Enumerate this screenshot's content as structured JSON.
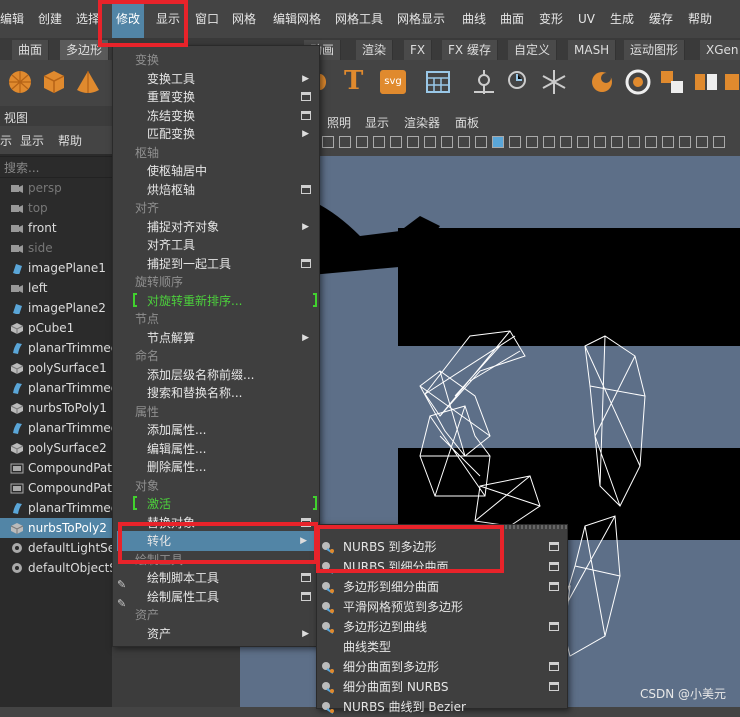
{
  "menubar": {
    "items": [
      "编辑",
      "创建",
      "选择",
      "修改",
      "显示",
      "窗口",
      "网格",
      "编辑网格",
      "网格工具",
      "网格显示",
      "曲线",
      "曲面",
      "变形",
      "UV",
      "生成",
      "缓存",
      "帮助"
    ],
    "active": "修改"
  },
  "shelf_tabs": [
    "曲面",
    "多边形",
    "动画",
    "渲染",
    "FX",
    "FX 缓存",
    "自定义",
    "MASH",
    "运动图形",
    "XGen"
  ],
  "shelf": {
    "text_icon": "T",
    "svg_icon": "svg"
  },
  "outliner": {
    "title": "视图",
    "menu": [
      "示",
      "显示",
      "帮助"
    ],
    "search_placeholder": "搜索...",
    "items": [
      {
        "label": "persp",
        "dim": true,
        "icon": "camera-icon"
      },
      {
        "label": "top",
        "dim": true,
        "icon": "camera-icon"
      },
      {
        "label": "front",
        "dim": false,
        "icon": "camera-icon"
      },
      {
        "label": "side",
        "dim": true,
        "icon": "camera-icon"
      },
      {
        "label": "imagePlane1",
        "icon": "image-plane-icon"
      },
      {
        "label": "left",
        "icon": "camera-icon"
      },
      {
        "label": "imagePlane2",
        "icon": "image-plane-icon"
      },
      {
        "label": "pCube1",
        "icon": "mesh-icon"
      },
      {
        "label": "planarTrimmed",
        "icon": "nurbs-surface-icon"
      },
      {
        "label": "polySurface1",
        "icon": "mesh-icon"
      },
      {
        "label": "planarTrimmed",
        "icon": "nurbs-surface-icon"
      },
      {
        "label": "nurbsToPoly1",
        "icon": "mesh-icon"
      },
      {
        "label": "planarTrimmed",
        "icon": "nurbs-surface-icon"
      },
      {
        "label": "polySurface2",
        "icon": "mesh-icon"
      },
      {
        "label": "CompoundPat",
        "icon": "group-icon"
      },
      {
        "label": "CompoundPat",
        "icon": "group-icon"
      },
      {
        "label": "planarTrimmed",
        "icon": "nurbs-surface-icon"
      },
      {
        "label": "nurbsToPoly2",
        "icon": "mesh-icon",
        "selected": true
      },
      {
        "label": "defaultLightSe",
        "icon": "set-icon"
      },
      {
        "label": "defaultObjectS",
        "icon": "set-icon"
      }
    ]
  },
  "viewport_menu": [
    "照明",
    "显示",
    "渲染器",
    "面板"
  ],
  "modify_menu": [
    {
      "label": "变换",
      "type": "section"
    },
    {
      "label": "变换工具",
      "arrow": true
    },
    {
      "label": "重置变换",
      "box": true
    },
    {
      "label": "冻结变换",
      "box": true
    },
    {
      "label": "匹配变换",
      "arrow": true
    },
    {
      "label": "枢轴",
      "type": "section"
    },
    {
      "label": "使枢轴居中"
    },
    {
      "label": "烘焙枢轴",
      "box": true
    },
    {
      "label": "对齐",
      "type": "section"
    },
    {
      "label": "捕捉对齐对象",
      "arrow": true
    },
    {
      "label": "对齐工具"
    },
    {
      "label": "捕捉到一起工具",
      "box": true
    },
    {
      "label": "旋转顺序",
      "type": "section"
    },
    {
      "label": "对旋转重新排序...",
      "green": true
    },
    {
      "label": "节点",
      "type": "section"
    },
    {
      "label": "节点解算",
      "arrow": true
    },
    {
      "label": "命名",
      "type": "section"
    },
    {
      "label": "添加层级名称前缀..."
    },
    {
      "label": "搜索和替换名称..."
    },
    {
      "label": "属性",
      "type": "section"
    },
    {
      "label": "添加属性..."
    },
    {
      "label": "编辑属性..."
    },
    {
      "label": "删除属性..."
    },
    {
      "label": "对象",
      "type": "section"
    },
    {
      "label": "激活",
      "green": true
    },
    {
      "label": "替换对象",
      "box": true
    },
    {
      "label": "转化",
      "arrow": true,
      "highlight": true
    },
    {
      "label": "绘制工具",
      "type": "section"
    },
    {
      "label": "绘制脚本工具",
      "box": true
    },
    {
      "label": "绘制属性工具",
      "box": true
    },
    {
      "label": "资产",
      "type": "section"
    },
    {
      "label": "资产",
      "arrow": true
    }
  ],
  "convert_submenu": [
    {
      "label": "NURBS 到多边形",
      "box": true
    },
    {
      "label": "NURBS 到细分曲面",
      "box": true
    },
    {
      "label": "多边形到细分曲面",
      "box": true
    },
    {
      "label": "平滑网格预览到多边形"
    },
    {
      "label": "多边形边到曲线",
      "box": true
    },
    {
      "label": "曲线类型",
      "noicon": true
    },
    {
      "label": "细分曲面到多边形",
      "box": true
    },
    {
      "label": "细分曲面到 NURBS",
      "box": true
    },
    {
      "label": "NURBS 曲线到 Bezier"
    }
  ],
  "watermark": "CSDN @小美元",
  "colors": {
    "accent": "#5285a6",
    "annotation": "#e8232a",
    "green_text": "#4cd03c",
    "viewport_bg": "#5d6f88"
  }
}
